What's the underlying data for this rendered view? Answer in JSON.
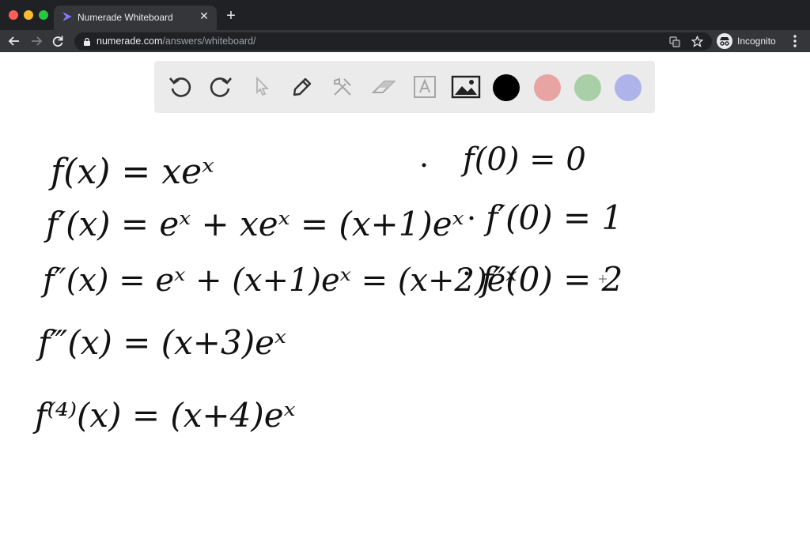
{
  "browser": {
    "tab_title": "Numerade Whiteboard",
    "tab_close": "✕",
    "new_tab": "+",
    "url_host": "numerade.com",
    "url_path": "/answers/whiteboard/",
    "profile_label": "Incognito"
  },
  "whiteboard": {
    "tools": [
      "undo-icon",
      "redo-icon",
      "select-icon",
      "pen-icon",
      "tools-icon",
      "eraser-icon",
      "text-icon",
      "image-icon"
    ],
    "colors": {
      "black": "#000000",
      "red": "#e8a3a3",
      "green": "#a8cfa8",
      "blue": "#aeb3ea"
    }
  },
  "handwriting": {
    "line1_left": "f(x) = xeˣ",
    "line1_right": "f(0) = 0",
    "line2_left": "f′(x) = eˣ + xeˣ = (x+1)eˣ",
    "line2_right": "f′(0) = 1",
    "line3_left": "f″(x) = eˣ + (x+1)eˣ = (x+2)eˣ",
    "line3_right": "f″(0) = 2",
    "line4": "f‴(x) = (x+3)eˣ",
    "line5": "f⁽⁴⁾(x) = (x+4)eˣ"
  }
}
